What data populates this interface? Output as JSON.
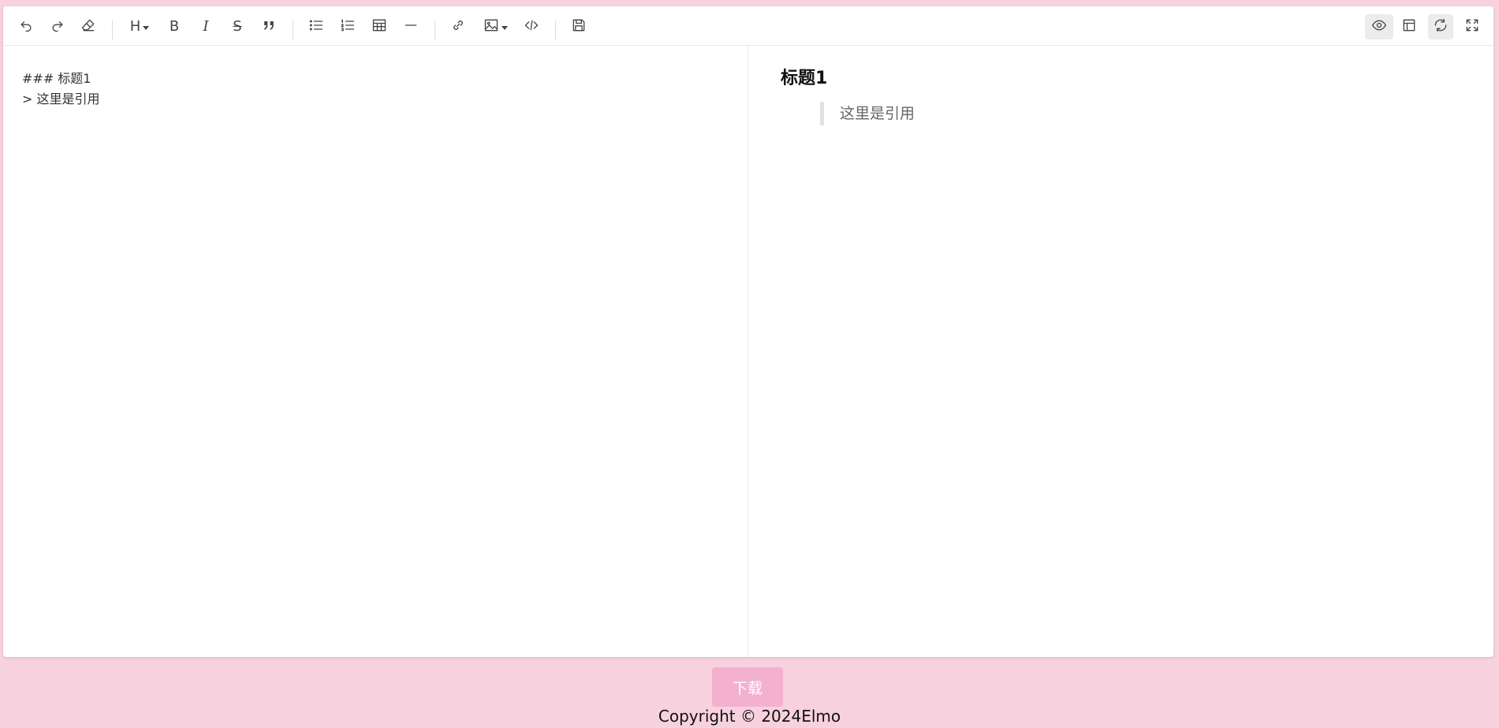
{
  "toolbar": {
    "left_tools": [
      {
        "name": "undo-icon"
      },
      {
        "name": "redo-icon"
      },
      {
        "name": "eraser-icon"
      },
      {
        "name": "heading-icon",
        "label": "H"
      },
      {
        "name": "bold-icon",
        "label": "B"
      },
      {
        "name": "italic-icon",
        "label": "I"
      },
      {
        "name": "strikethrough-icon",
        "label": "S"
      },
      {
        "name": "quote-icon"
      },
      {
        "name": "unordered-list-icon"
      },
      {
        "name": "ordered-list-icon"
      },
      {
        "name": "table-icon"
      },
      {
        "name": "horizontal-rule-icon"
      },
      {
        "name": "link-icon"
      },
      {
        "name": "image-icon"
      },
      {
        "name": "code-icon"
      },
      {
        "name": "save-icon"
      }
    ],
    "right_tools": [
      {
        "name": "preview-eye-icon",
        "active": true
      },
      {
        "name": "toc-layout-icon",
        "active": false
      },
      {
        "name": "sync-scroll-icon",
        "active": true
      },
      {
        "name": "fullscreen-icon",
        "active": false
      }
    ]
  },
  "source": {
    "lines": [
      "### 标题1",
      "> 这里是引用"
    ]
  },
  "preview": {
    "heading": "标题1",
    "quote": "这里是引用"
  },
  "footer": {
    "download_label": "下载",
    "copyright": "Copyright © 2024Elmo"
  },
  "colors": {
    "page_background": "#f7d1de",
    "download_button": "#f3b1cf"
  }
}
